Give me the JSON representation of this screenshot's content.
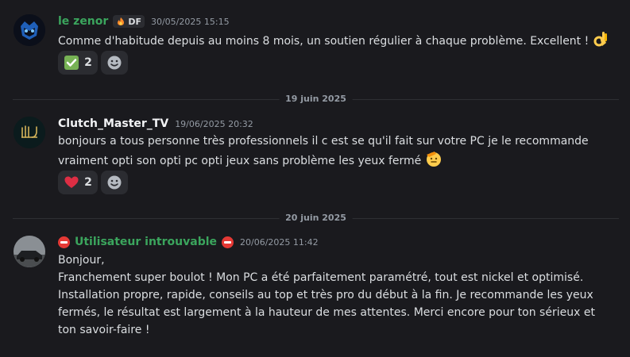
{
  "messages": [
    {
      "author": "le zenor",
      "author_color": "#3ba55d",
      "tag": "DF",
      "timestamp": "30/05/2025 15:15",
      "text": "Comme d'habitude depuis au moins 8 mois, un soutien régulier à chaque problème. Excellent !",
      "emoji_icon": "ok-hand-icon",
      "reactions": [
        {
          "icon": "check-mark-icon",
          "count": "2"
        }
      ]
    },
    {
      "date_divider": "19 juin 2025",
      "author": "Clutch_Master_TV",
      "author_color": "#f2f3f5",
      "timestamp": "19/06/2025 20:32",
      "text": "bonjours a tous personne très professionnels il c est se qu'il  fait sur votre PC je le recommande vraiment opti son opti pc opti jeux sans problème les yeux fermé",
      "emoji_icon": "saluting-face-icon",
      "reactions": [
        {
          "icon": "heart-icon",
          "count": "2"
        }
      ]
    },
    {
      "date_divider": "20 juin 2025",
      "author": "Utilisateur introuvable",
      "author_color": "#3ba55d",
      "timestamp": "20/06/2025 11:42",
      "text_lines": [
        "Bonjour,",
        "Franchement super boulot ! Mon PC a été parfaitement paramétré, tout est nickel et optimisé. Installation propre, rapide, conseils au top et très pro du début à la fin. Je recommande les yeux fermés, le résultat est largement à la hauteur de mes attentes. Merci encore pour ton sérieux et ton savoir-faire !"
      ]
    }
  ]
}
